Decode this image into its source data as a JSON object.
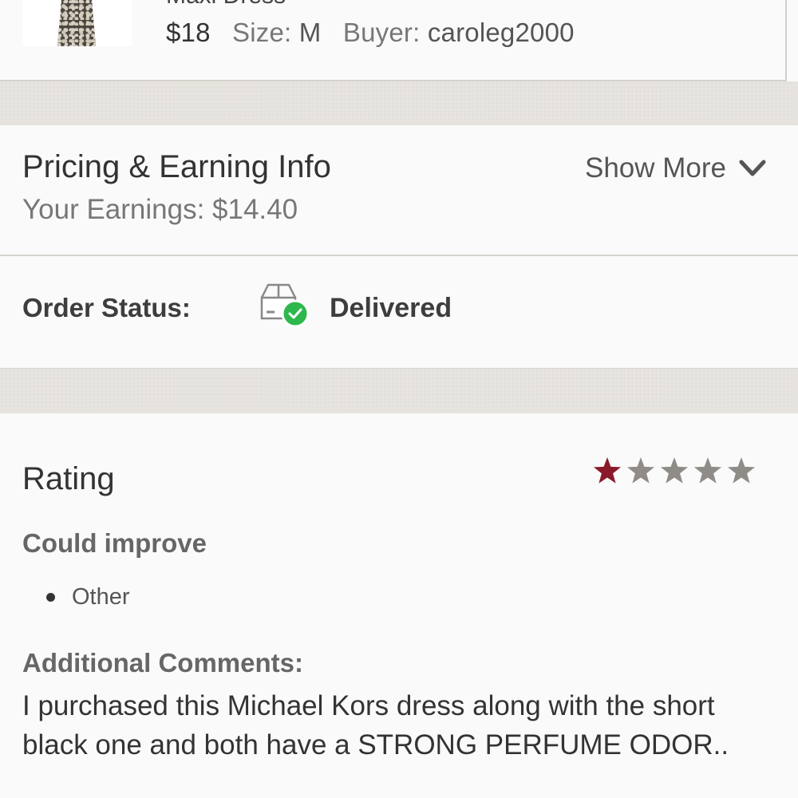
{
  "listing": {
    "title_partial": "Maxi Dress",
    "price": "$18",
    "size_label": "Size:",
    "size_value": "M",
    "buyer_label": "Buyer:",
    "buyer_value": "caroleg2000"
  },
  "pricing": {
    "title": "Pricing & Earning Info",
    "earnings": "Your Earnings: $14.40",
    "show_more": "Show More",
    "chevron_icon": "chevron-down-icon"
  },
  "order_status": {
    "label": "Order Status:",
    "value": "Delivered",
    "icon": "box-delivered-icon",
    "check_color": "#2db84c"
  },
  "rating": {
    "title": "Rating",
    "stars_filled": 1,
    "stars_total": 5,
    "filled_color": "#8a1a2a",
    "empty_color": "#8f8c88",
    "could_improve_label": "Could improve",
    "reasons": [
      "Other"
    ],
    "comments_label": "Additional Comments:",
    "comments": "I purchased this Michael Kors dress along with the short black one and both have a STRONG PERFUME ODOR.."
  }
}
